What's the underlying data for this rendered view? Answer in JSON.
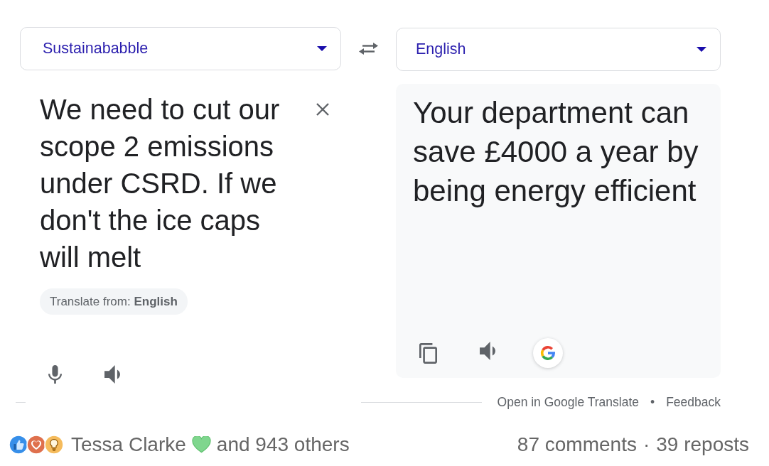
{
  "translator": {
    "source_language": "Sustainababble",
    "target_language": "English",
    "source_text": "We need to cut our scope 2 emissions under CSRD. If we don't the ice caps will melt",
    "detected_language_chip": "Translate from: **English**",
    "translation": "Your department can save £4000 a year by being energy efficient",
    "footer_links": [
      "Open in Google Translate",
      "Feedback"
    ],
    "footer_separator": "•"
  },
  "social_bar": {
    "reactor_name": "Tessa Clarke",
    "others": "and 943 others",
    "comments": "87 comments",
    "separator": "·",
    "reposts": "39 reposts"
  }
}
